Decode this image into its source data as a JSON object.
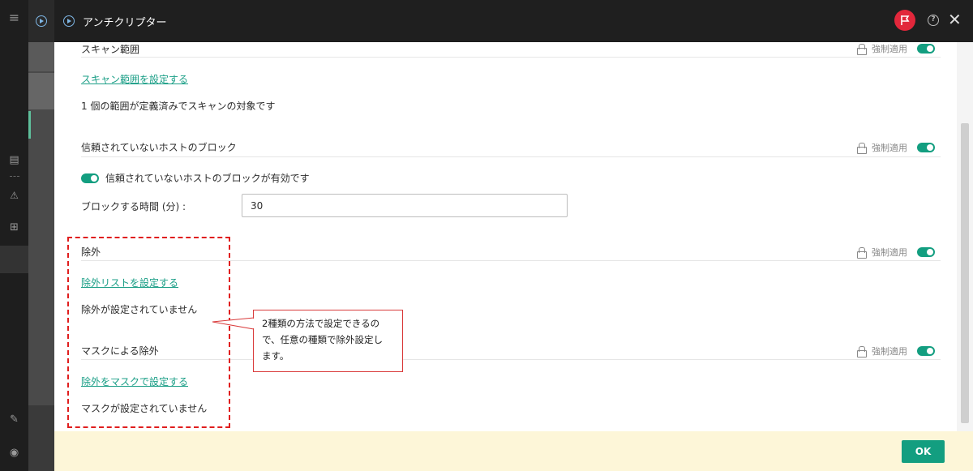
{
  "window": {
    "title": "アンチクリプター"
  },
  "enforce_label": "強制適用",
  "sections": {
    "scan_scope": {
      "title": "スキャン範囲",
      "link": "スキャン範囲を設定する",
      "status": "1 個の範囲が定義済みでスキャンの対象です"
    },
    "block_hosts": {
      "title": "信頼されていないホストのブロック",
      "toggle_label": "信頼されていないホストのブロックが有効です",
      "duration_label": "ブロックする時間 (分) :",
      "duration_value": "30"
    },
    "exclusions": {
      "title": "除外",
      "link": "除外リストを設定する",
      "status": "除外が設定されていません"
    },
    "mask_exclusions": {
      "title": "マスクによる除外",
      "link": "除外をマスクで設定する",
      "status": "マスクが設定されていません"
    }
  },
  "callout": {
    "line1": "2種類の方法で設定できるの",
    "line2": "で、任意の種類で除外設定し",
    "line3": "ます。"
  },
  "footer": {
    "ok_label": "OK"
  },
  "colors": {
    "accent": "#139e80",
    "annotation": "#e01e1e",
    "footer_bg": "#fdf6d8",
    "flag": "#e2273b"
  }
}
